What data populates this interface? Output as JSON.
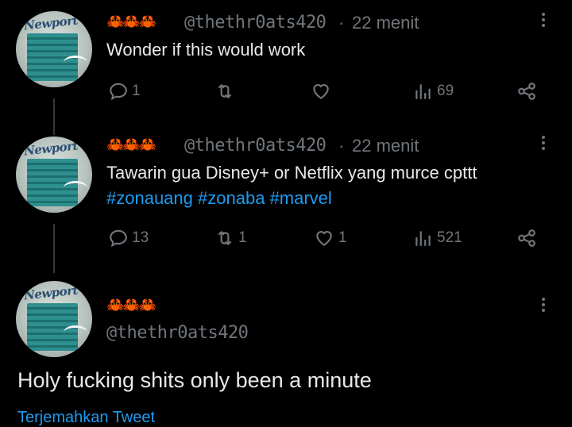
{
  "colors": {
    "background": "#000000",
    "text": "#e7e9ea",
    "muted": "#71767b",
    "link": "#1d9bf0",
    "crab": "#e0541e"
  },
  "avatar_brand": "Newport",
  "tweets": [
    {
      "crabs": "🦀🦀🦀",
      "handle": "@thethr0ats420",
      "separator": "·",
      "time": "22 menit",
      "text": "Wonder if this would work",
      "actions": {
        "reply": "1",
        "retweet": "",
        "like": "",
        "views": "69"
      }
    },
    {
      "crabs": "🦀🦀🦀",
      "handle": "@thethr0ats420",
      "separator": "·",
      "time": "22 menit",
      "text": "Tawarin gua Disney+ or Netflix yang murce cpttt",
      "hashtags": [
        "#zonauang",
        "#zonaba",
        "#marvel"
      ],
      "actions": {
        "reply": "13",
        "retweet": "1",
        "like": "1",
        "views": "521"
      }
    },
    {
      "crabs": "🦀🦀🦀",
      "handle": "@thethr0ats420",
      "text": "Holy fucking shits only been a minute",
      "translate": "Terjemahkan Tweet"
    }
  ]
}
